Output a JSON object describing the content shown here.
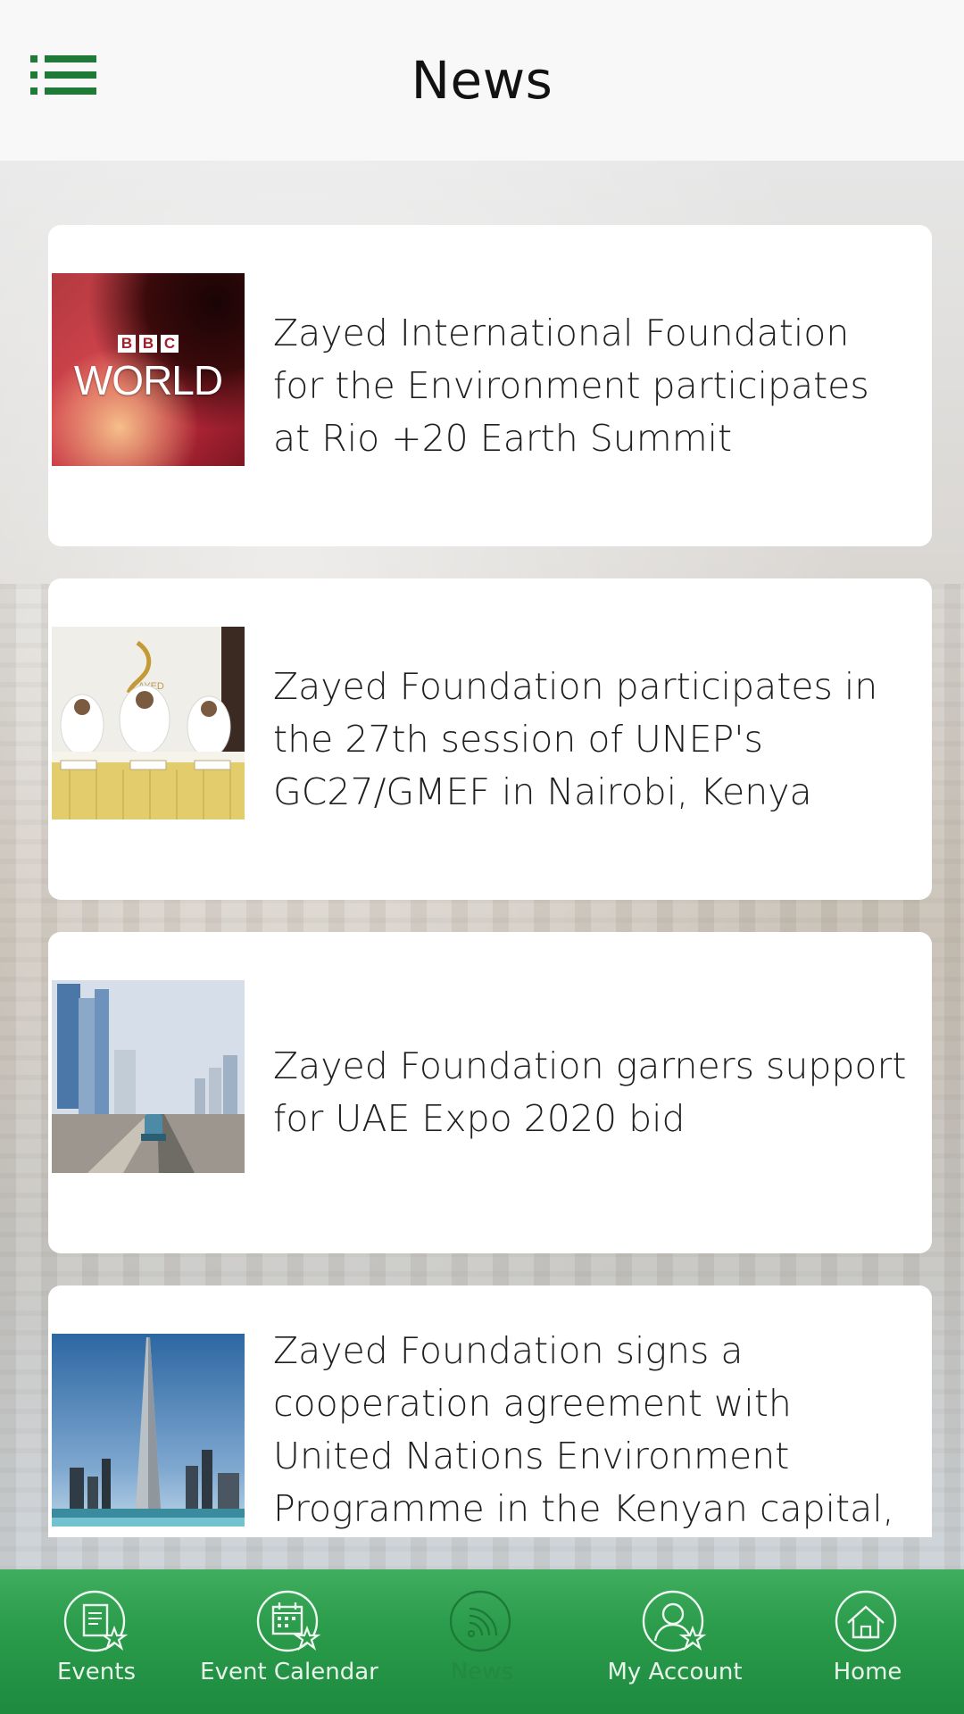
{
  "header": {
    "title": "News",
    "menu_icon": "list-menu-icon"
  },
  "news": [
    {
      "title": "Zayed International Foundation for the Environment participates at Rio +20 Earth Summit",
      "thumb_text_top": "BBC",
      "thumb_text_main": "WORLD"
    },
    {
      "title": "Zayed Foundation participates in the 27th session of UNEP's GC27/GMEF in Nairobi, Kenya",
      "thumb_text": "ZAYED"
    },
    {
      "title": "Zayed Foundation garners support for UAE Expo 2020 bid"
    },
    {
      "title": "Zayed Foundation signs a cooperation agreement with United Nations Environment Programme in the Kenyan capital, Nairobi"
    }
  ],
  "bottom_nav": [
    {
      "label": "Events",
      "icon": "events-icon"
    },
    {
      "label": "Event Calendar",
      "icon": "event-calendar-icon"
    },
    {
      "label": "News",
      "icon": "news-feed-icon",
      "active": true
    },
    {
      "label": "My Account",
      "icon": "account-icon"
    },
    {
      "label": "Home",
      "icon": "home-icon"
    }
  ],
  "colors": {
    "brand_green": "#238a3f",
    "nav_gradient_top": "#3fae5f",
    "nav_gradient_bottom": "#1d8a3f"
  }
}
